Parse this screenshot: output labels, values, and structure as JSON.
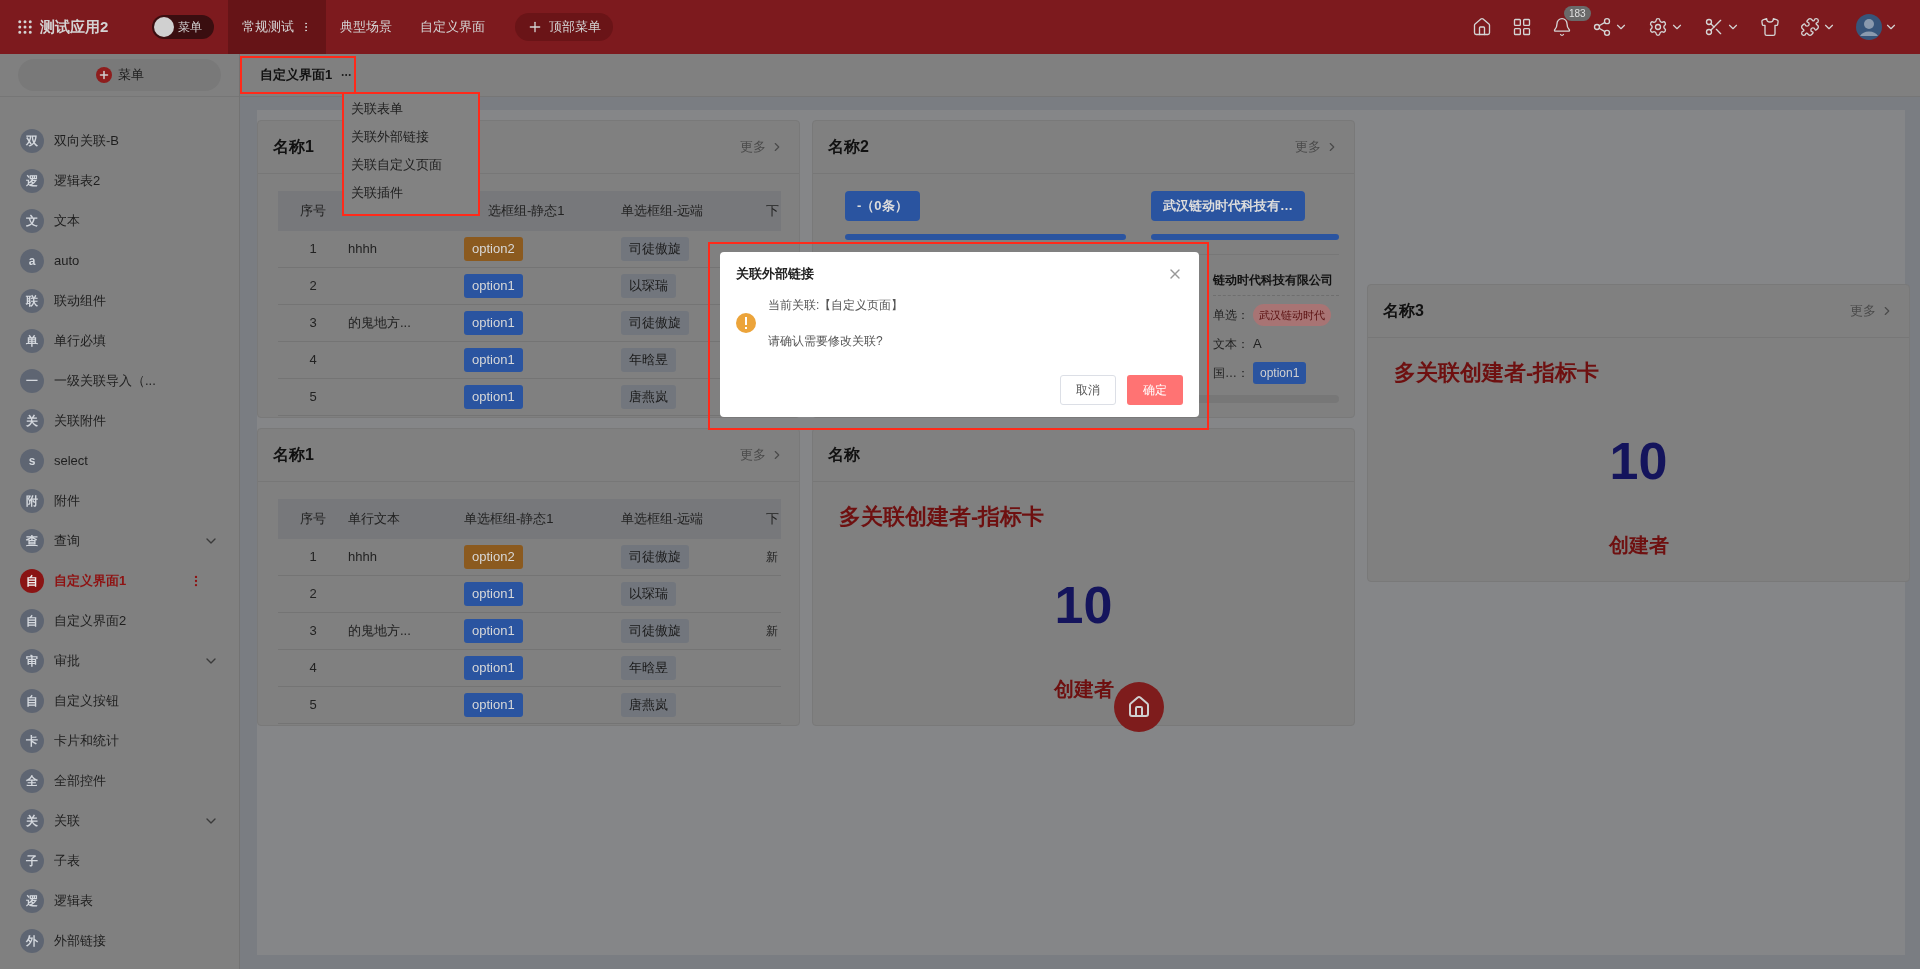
{
  "app": {
    "title": "测试应用2"
  },
  "menu_toggle": {
    "label": "菜单",
    "on": false
  },
  "top_nav": [
    {
      "label": "常规测试",
      "selected": true,
      "kind": "dropdown"
    },
    {
      "label": "典型场景",
      "selected": false,
      "kind": "plain"
    },
    {
      "label": "自定义界面",
      "selected": false,
      "kind": "plain"
    },
    {
      "label": "顶部菜单",
      "selected": false,
      "kind": "add"
    }
  ],
  "header_icons": [
    {
      "kind": "home",
      "dropdown": false
    },
    {
      "kind": "apps",
      "dropdown": false
    },
    {
      "kind": "bell",
      "dropdown": false,
      "badge": "183"
    },
    {
      "kind": "share",
      "dropdown": true
    },
    {
      "kind": "settings",
      "dropdown": true
    },
    {
      "kind": "tools",
      "dropdown": true
    },
    {
      "kind": "shirt",
      "dropdown": false
    },
    {
      "kind": "puzzle",
      "dropdown": true
    },
    {
      "kind": "avatar",
      "dropdown": true
    }
  ],
  "sidebar": {
    "add_button": "菜单",
    "items": [
      {
        "badge": "双",
        "label": "双向关联-B",
        "kind": "page",
        "selected": false
      },
      {
        "badge": "逻",
        "label": "逻辑表2",
        "kind": "page",
        "selected": false
      },
      {
        "badge": "文",
        "label": "文本",
        "kind": "page",
        "selected": false
      },
      {
        "badge": "a",
        "label": "auto",
        "kind": "page",
        "selected": false
      },
      {
        "badge": "联",
        "label": "联动组件",
        "kind": "page",
        "selected": false
      },
      {
        "badge": "单",
        "label": "单行必填",
        "kind": "page",
        "selected": false
      },
      {
        "badge": "一",
        "label": "一级关联导入（...",
        "kind": "page",
        "selected": false
      },
      {
        "badge": "关",
        "label": "关联附件",
        "kind": "page",
        "selected": false
      },
      {
        "badge": "s",
        "label": "select",
        "kind": "page",
        "selected": false
      },
      {
        "badge": "附",
        "label": "附件",
        "kind": "page",
        "selected": false
      },
      {
        "badge": "查",
        "label": "查询",
        "kind": "group",
        "selected": false
      },
      {
        "badge": "自",
        "label": "自定义界面1",
        "kind": "page",
        "selected": true
      },
      {
        "badge": "自",
        "label": "自定义界面2",
        "kind": "page",
        "selected": false
      },
      {
        "badge": "审",
        "label": "审批",
        "kind": "group",
        "selected": false
      },
      {
        "badge": "自",
        "label": "自定义按钮",
        "kind": "page",
        "selected": false
      },
      {
        "badge": "卡",
        "label": "卡片和统计",
        "kind": "page",
        "selected": false
      },
      {
        "badge": "全",
        "label": "全部控件",
        "kind": "page",
        "selected": false
      },
      {
        "badge": "关",
        "label": "关联",
        "kind": "group",
        "selected": false
      },
      {
        "badge": "子",
        "label": "子表",
        "kind": "page",
        "selected": false
      },
      {
        "badge": "逻",
        "label": "逻辑表",
        "kind": "page",
        "selected": false
      },
      {
        "badge": "外",
        "label": "外部链接",
        "kind": "page",
        "selected": false
      }
    ]
  },
  "tabs": [
    {
      "label": "自定义界面1",
      "selected": true
    }
  ],
  "context_menu": [
    "关联表单",
    "关联外部链接",
    "关联自定义页面",
    "关联插件"
  ],
  "columns": [
    [
      {
        "kind": "table",
        "title": "名称1",
        "more": "更多",
        "headers": {
          "index": "序号",
          "static_tail": "选框组-静态1",
          "remote": "单选框组-远端",
          "column_5": "下"
        },
        "rows": [
          {
            "index": "1",
            "text": "hhhh",
            "option": {
              "label": "option2",
              "color": "#8b5a1f"
            },
            "remote": "司徒傲旋"
          },
          {
            "index": "2",
            "option": {
              "label": "option1",
              "color": "#2a54a0"
            },
            "remote": "以琛瑞"
          },
          {
            "index": "3",
            "text": "的鬼地方...",
            "option": {
              "label": "option1",
              "color": "#2a54a0"
            },
            "remote": "司徒傲旋"
          },
          {
            "index": "4",
            "option": {
              "label": "option1",
              "color": "#2a54a0"
            },
            "remote": "年晗昱"
          },
          {
            "index": "5",
            "option": {
              "label": "option1",
              "color": "#2a54a0"
            },
            "remote": "唐燕岚"
          }
        ]
      },
      {
        "kind": "table",
        "title": "名称1",
        "more": "更多",
        "headers": {
          "index": "序号",
          "text": "单行文本",
          "static": "单选框组-静态1",
          "remote": "单选框组-远端",
          "column_5": "下"
        },
        "rows": [
          {
            "index": "1",
            "text": "hhhh",
            "option": {
              "label": "option2",
              "color": "#8b5a1f"
            },
            "remote": "司徒傲旋",
            "extra": "新"
          },
          {
            "index": "2",
            "option": {
              "label": "option1",
              "color": "#2a54a0"
            },
            "remote": "以琛瑞"
          },
          {
            "index": "3",
            "text": "的鬼地方...",
            "option": {
              "label": "option1",
              "color": "#2a54a0"
            },
            "remote": "司徒傲旋",
            "extra": "新"
          },
          {
            "index": "4",
            "option": {
              "label": "option1",
              "color": "#2a54a0"
            },
            "remote": "年晗昱"
          },
          {
            "index": "5",
            "option": {
              "label": "option1",
              "color": "#2a54a0"
            },
            "remote": "唐燕岚"
          }
        ]
      }
    ],
    [
      {
        "kind": "relation",
        "title": "名称2",
        "more": "更多",
        "groups": [
          {
            "button": "-（0条）"
          },
          {
            "button": "武汉链动时代科技有…",
            "record": {
              "name": "链动时代科技有限公司",
              "fields": [
                {
                  "label": "单选：",
                  "kind": "tag",
                  "value": "武汉链动时代"
                },
                {
                  "label": "文本：",
                  "kind": "text",
                  "value": "A"
                },
                {
                  "label": "国…：",
                  "kind": "option",
                  "value": "option1"
                }
              ]
            }
          }
        ]
      },
      {
        "kind": "metric",
        "title": "名称",
        "heading": "多关联创建者-指标卡",
        "value": "10",
        "caption": "创建者"
      }
    ],
    [
      {
        "kind": "metric",
        "title": "名称3",
        "more": "更多",
        "heading": "多关联创建者-指标卡",
        "value": "10",
        "caption": "创建者"
      }
    ]
  ],
  "dialog": {
    "title": "关联外部链接",
    "lines": [
      "当前关联:【自定义页面】",
      "请确认需要修改关联?"
    ],
    "cancel": "取消",
    "confirm": "确定"
  }
}
